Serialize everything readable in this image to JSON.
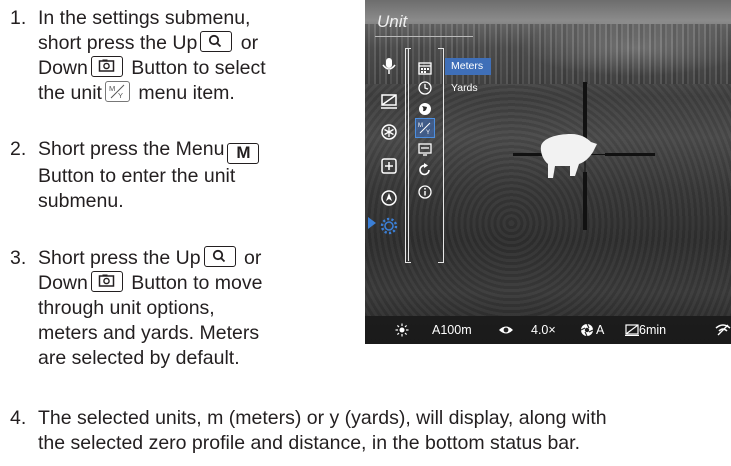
{
  "steps": [
    {
      "num": "1.",
      "lines": [
        {
          "text": "In the settings submenu,"
        },
        {
          "text": "short press the Up",
          "after_icon": "magnifier-icon",
          "tail": " or"
        },
        {
          "text": "Down",
          "after_icon": "camera-icon",
          "tail": " Button to select"
        },
        {
          "text": "the unit",
          "after_icon": "unit-icon",
          "tail": " menu item."
        }
      ]
    },
    {
      "num": "2.",
      "lines": [
        {
          "text": "Short press the Menu",
          "after_icon": "m-key",
          "key_label": "M"
        },
        {
          "text": "Button to enter the unit"
        },
        {
          "text": "submenu."
        }
      ]
    },
    {
      "num": "3.",
      "lines": [
        {
          "text": "Short press the Up",
          "after_icon": "magnifier-icon",
          "tail": " or"
        },
        {
          "text": "Down",
          "after_icon": "camera-icon",
          "tail": " Button to move"
        },
        {
          "text": "through unit options,"
        },
        {
          "text": "meters and yards. Meters"
        },
        {
          "text": "are selected by default."
        }
      ]
    },
    {
      "num": "4.",
      "lines": [
        {
          "text": "The selected units, m (meters) or y (yards), will display, along with"
        },
        {
          "text": "the selected zero profile and distance, in the bottom status bar."
        }
      ]
    }
  ],
  "screen": {
    "title": "Unit",
    "options": [
      "Meters",
      "Yards"
    ],
    "selected_option": "Meters",
    "left_icons": [
      "microphone-icon",
      "no-display-icon",
      "brightness-icon",
      "plus-square-icon",
      "compass-icon",
      "gear-icon"
    ],
    "right_icons": [
      "calendar-icon",
      "clock-icon",
      "globe-icon",
      "unit-icon",
      "display-icon",
      "reset-icon",
      "info-icon"
    ],
    "status": {
      "brightness_icon": "sun-icon",
      "zero_profile": "A100m",
      "eye_icon": "eye-icon",
      "zoom": "4.0×",
      "mode_icon": "aperture-icon",
      "mode": "A",
      "timer_icon": "screen-off-icon",
      "timer": "6min",
      "wifi_icon": "wifi-icon"
    },
    "colors": {
      "highlight": "#3f6fb8",
      "arrow": "#3b7fd6",
      "gear": "#3b7fd6"
    }
  }
}
